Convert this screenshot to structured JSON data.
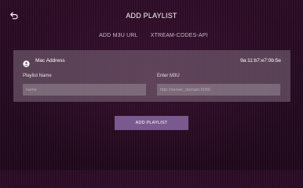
{
  "header": {
    "title": "ADD PLAYLIST",
    "back_icon": "back-arrow-icon"
  },
  "tabs": [
    {
      "label": "ADD M3U URL"
    },
    {
      "label": "XTREAM-CODES-API"
    }
  ],
  "device": {
    "mac_label": "Mac Address",
    "mac_value": "9a:11:b7:e7:0b:5e",
    "icon": "account-circle-icon"
  },
  "form": {
    "playlist_name_label": "Playlist Name",
    "playlist_name_placeholder": "name",
    "m3u_label": "Enter M3U",
    "m3u_placeholder": "http://server_domain:8080"
  },
  "actions": {
    "add_label": "ADD PLAYLIST"
  },
  "colors": {
    "background": "#240a20",
    "panel": "#7a6274",
    "button": "#7a5a8e"
  }
}
